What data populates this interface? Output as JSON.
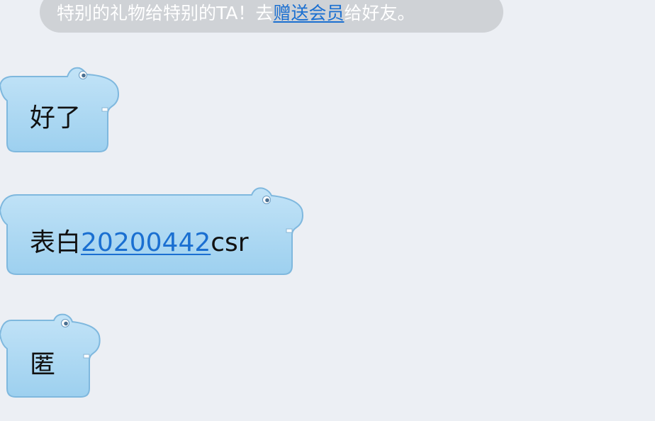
{
  "system_notice": {
    "prefix": "特别的礼物给特别的TA！去",
    "link": "赠送会员",
    "suffix": "给好友。"
  },
  "messages": [
    {
      "text": "好了"
    },
    {
      "text": "表白",
      "link": "20200442",
      "suffix": "csr"
    },
    {
      "text": "匿"
    }
  ],
  "colors": {
    "background": "#eceff4",
    "bubble_fill": "#a9d7f2",
    "bubble_border": "#7fb8de",
    "link": "#1a6fd1",
    "notice_bg": "#cfd2d6"
  }
}
